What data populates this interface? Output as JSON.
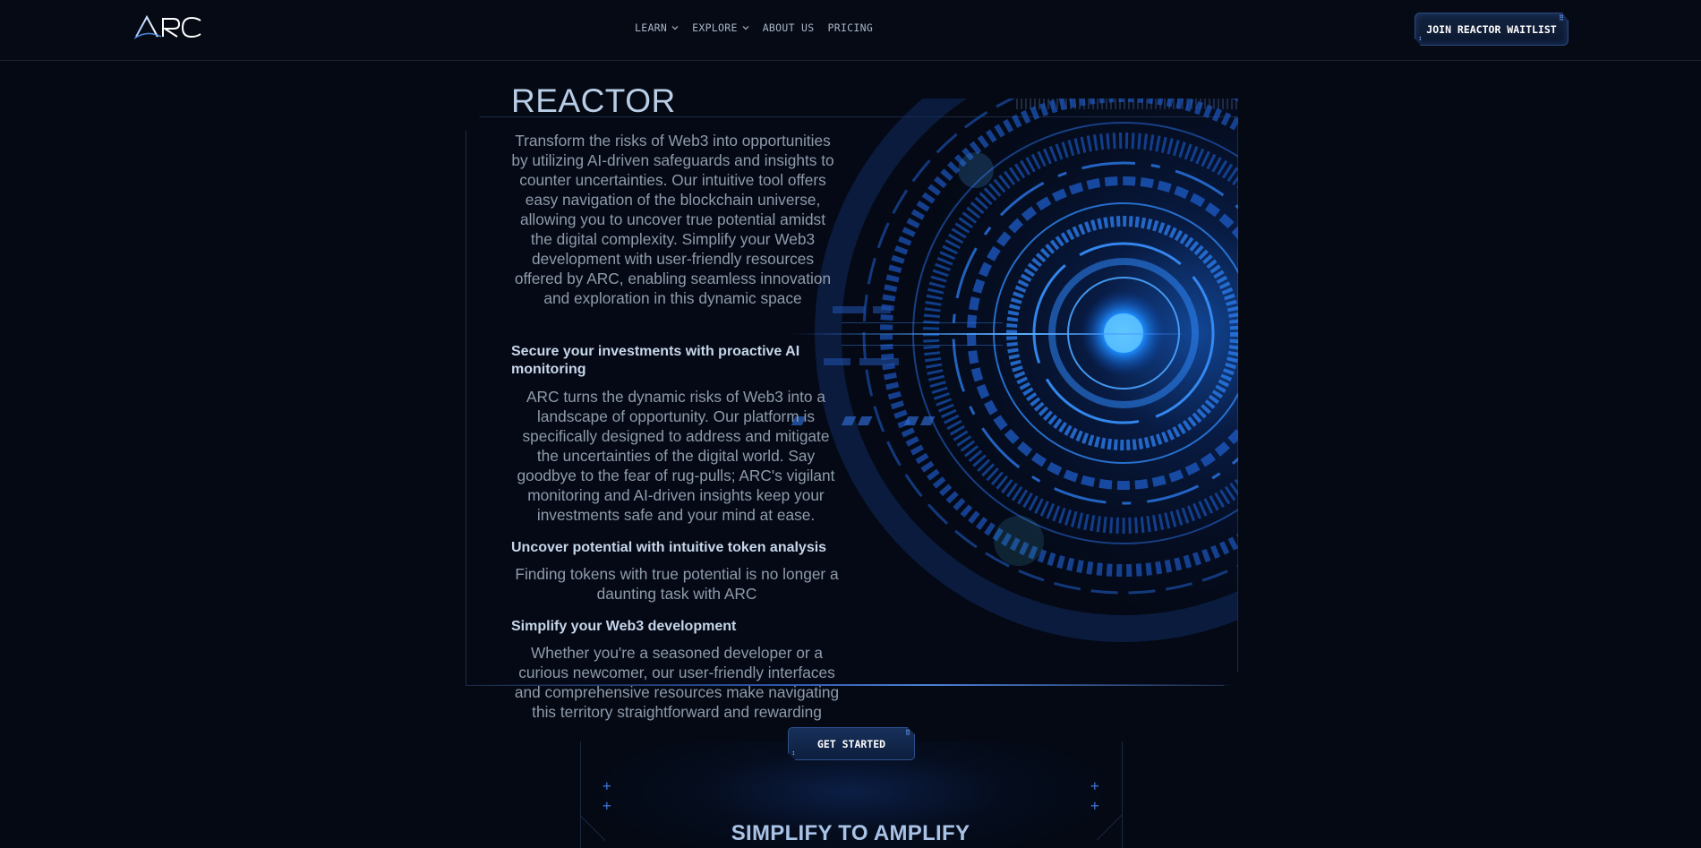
{
  "nav": {
    "logo_text": "ARC",
    "links": [
      {
        "label": "LEARN",
        "dropdown": true
      },
      {
        "label": "EXPLORE",
        "dropdown": true
      },
      {
        "label": "ABOUT US",
        "dropdown": false
      },
      {
        "label": "PRICING",
        "dropdown": false
      }
    ],
    "cta_label": "JOIN REACTOR WAITLIST"
  },
  "hero": {
    "title": "REACTOR",
    "intro": "Transform the risks of Web3 into opportunities by utilizing AI-driven safeguards and insights to counter uncertainties. Our intuitive tool offers easy navigation of the blockchain universe, allowing you to uncover true potential amidst the digital complexity. Simplify your Web3 development with user-friendly resources offered by ARC, enabling seamless innovation and exploration in this dynamic space",
    "sections": [
      {
        "heading": "Secure your investments with proactive AI monitoring",
        "body": "ARC turns the dynamic risks of Web3 into a landscape of opportunity. Our platform is specifically designed to address and mitigate the uncertainties of the digital world. Say goodbye to the fear of rug-pulls; ARC's vigilant monitoring and AI-driven insights keep your investments safe and your mind at ease."
      },
      {
        "heading": "Uncover potential  with intuitive token analysis",
        "body": "Finding tokens with true potential is no longer a daunting task with ARC"
      },
      {
        "heading": "Simplify your Web3 development",
        "body": "Whether you're a seasoned developer or a curious newcomer, our user-friendly interfaces and comprehensive resources make navigating this territory straightforward and rewarding"
      }
    ],
    "cta_label": "GET STARTED"
  },
  "section2": {
    "title": "SIMPLIFY TO AMPLIFY"
  },
  "colors": {
    "background": "#040914",
    "accent": "#2d6fe0",
    "title": "#b9cde6",
    "body_text": "#8f9bab"
  }
}
